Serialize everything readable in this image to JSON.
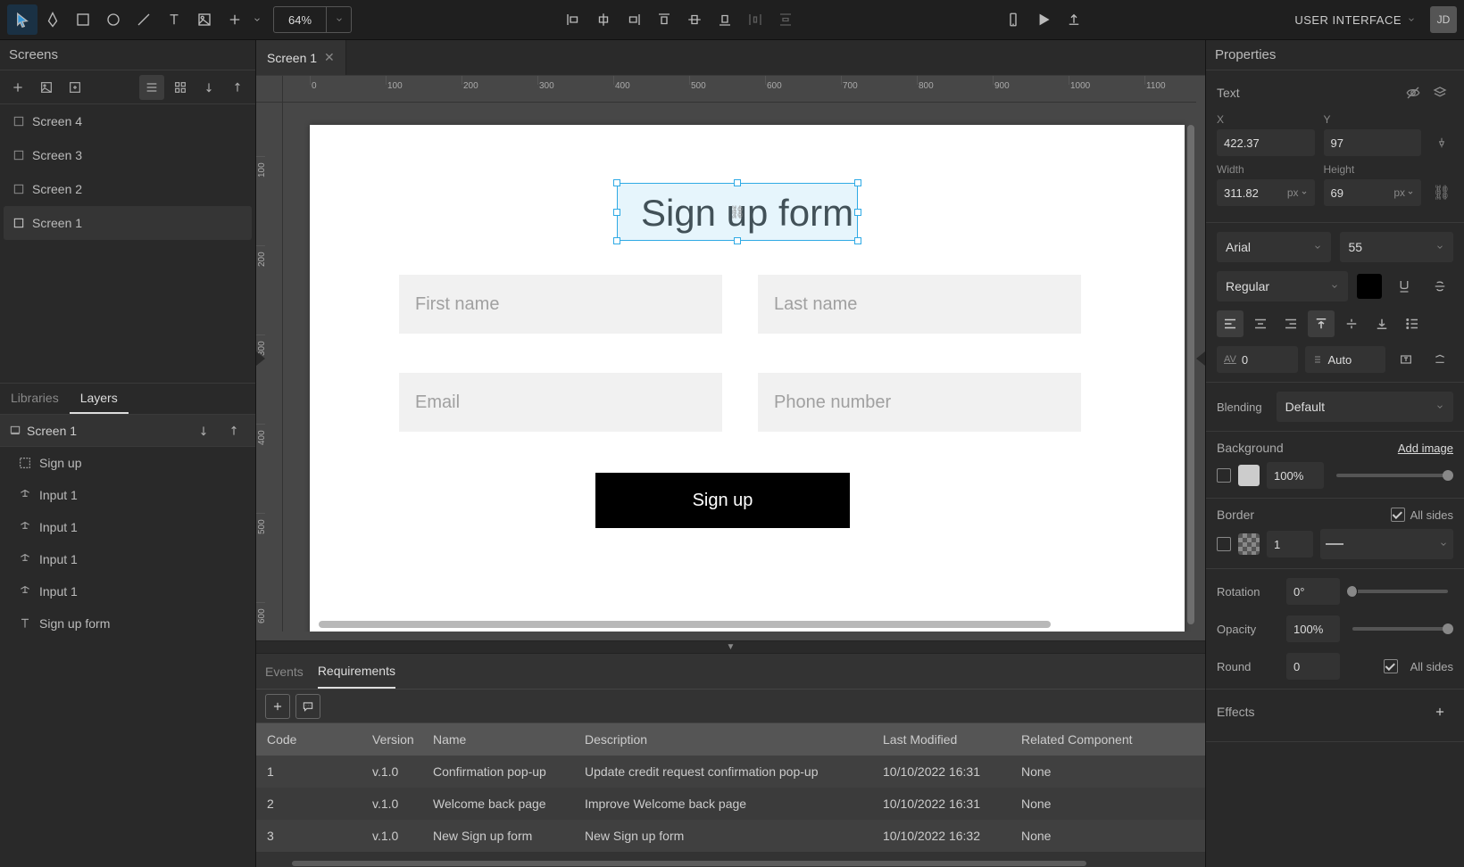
{
  "topbar": {
    "zoom": "64%",
    "user_dropdown": "USER INTERFACE",
    "avatar_initials": "JD"
  },
  "sidebar": {
    "header": "Screens",
    "screens": [
      "Screen 4",
      "Screen 3",
      "Screen 2",
      "Screen 1"
    ],
    "left_tab_libraries": "Libraries",
    "left_tab_layers": "Layers",
    "layers_header": "Screen 1",
    "layers": [
      {
        "icon": "group",
        "label": "Sign up"
      },
      {
        "icon": "text",
        "label": "Input 1"
      },
      {
        "icon": "text",
        "label": "Input 1"
      },
      {
        "icon": "text",
        "label": "Input 1"
      },
      {
        "icon": "text",
        "label": "Input 1"
      },
      {
        "icon": "text",
        "label": "Sign up form"
      }
    ]
  },
  "center": {
    "tab_name": "Screen 1",
    "ruler_h": [
      "0",
      "100",
      "200",
      "300",
      "400",
      "500",
      "600",
      "700",
      "800",
      "900",
      "1000",
      "1100"
    ],
    "ruler_v": [
      "100",
      "200",
      "300",
      "400",
      "500",
      "600"
    ]
  },
  "mockup": {
    "title": "Sign up form",
    "first_name": "First name",
    "last_name": "Last name",
    "email": "Email",
    "phone": "Phone number",
    "button": "Sign up"
  },
  "bottom": {
    "tab_events": "Events",
    "tab_requirements": "Requirements",
    "columns": {
      "code": "Code",
      "version": "Version",
      "name": "Name",
      "description": "Description",
      "last_modified": "Last Modified",
      "related": "Related Component"
    },
    "rows": [
      {
        "code": "1",
        "version": "v.1.0",
        "name": "Confirmation pop-up",
        "description": "Update credit request confirmation pop-up",
        "last_modified": "10/10/2022 16:31",
        "related": "None"
      },
      {
        "code": "2",
        "version": "v.1.0",
        "name": "Welcome back page",
        "description": "Improve Welcome back page",
        "last_modified": "10/10/2022 16:31",
        "related": "None"
      },
      {
        "code": "3",
        "version": "v.1.0",
        "name": "New Sign up form",
        "description": "New Sign up form",
        "last_modified": "10/10/2022 16:32",
        "related": "None"
      }
    ]
  },
  "props": {
    "header": "Properties",
    "text_label": "Text",
    "labels": {
      "x": "X",
      "y": "Y",
      "width": "Width",
      "height": "Height",
      "px": "px"
    },
    "x": "422.37",
    "y": "97",
    "width": "311.82",
    "height": "69",
    "font_family": "Arial",
    "font_size": "55",
    "font_weight": "Regular",
    "kerning": "0",
    "line_height": "Auto",
    "blending_label": "Blending",
    "blending": "Default",
    "background_label": "Background",
    "add_image": "Add image",
    "bg_opacity": "100%",
    "border_label": "Border",
    "all_sides": "All sides",
    "border_width": "1",
    "rotation_label": "Rotation",
    "rotation": "0°",
    "opacity_label": "Opacity",
    "opacity": "100%",
    "round_label": "Round",
    "round": "0",
    "effects_label": "Effects"
  }
}
